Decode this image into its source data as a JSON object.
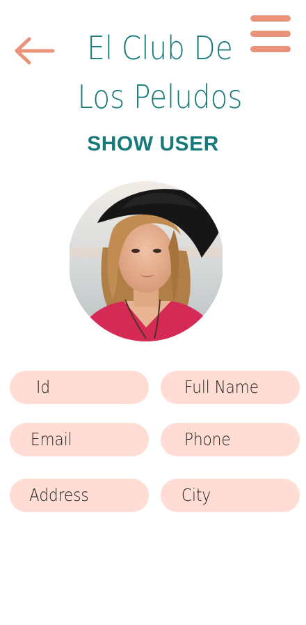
{
  "header": {
    "title": "El Club De Los Peludos",
    "subtitle": "SHOW USER"
  },
  "icons": {
    "back": "arrow-left-icon",
    "menu": "hamburger-menu-icon"
  },
  "colors": {
    "title": "#17797a",
    "accent": "#e8937a",
    "field_bg": "#ffddd4"
  },
  "form": {
    "id_label": "Id",
    "full_name_label": "Full Name",
    "email_label": "Email",
    "phone_label": "Phone",
    "address_label": "Address",
    "city_label": "City"
  }
}
